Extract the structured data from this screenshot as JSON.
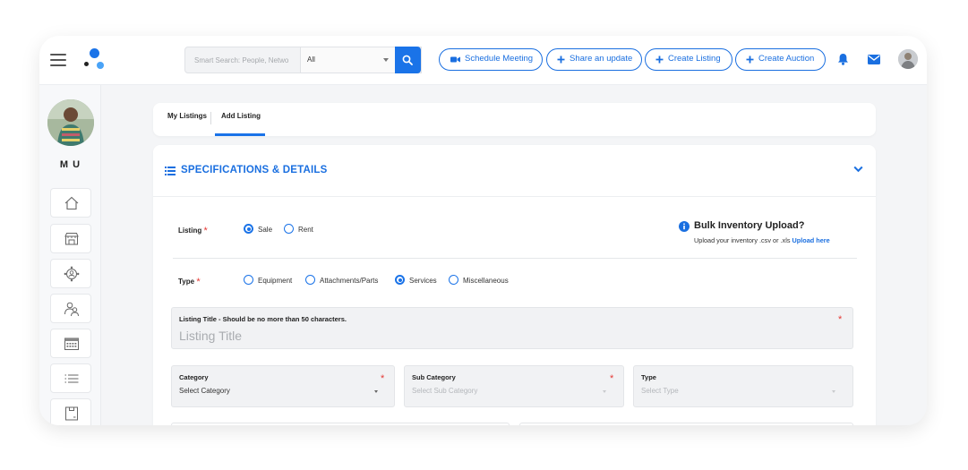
{
  "topbar": {
    "search": {
      "placeholder": "Smart Search: People, Netwo",
      "scope": "All"
    },
    "actions": [
      {
        "label": "Schedule Meeting",
        "icon": "video-camera-icon"
      },
      {
        "label": "Share an update",
        "icon": "plus-icon"
      },
      {
        "label": "Create Listing",
        "icon": "plus-icon"
      },
      {
        "label": "Create Auction",
        "icon": "plus-icon"
      }
    ],
    "icons": [
      "hamburger-icon",
      "bell-icon",
      "mail-icon",
      "search-icon"
    ],
    "accent": "#1a73e8"
  },
  "sidebar": {
    "user_initials": "M U",
    "items": [
      "home-icon",
      "store-icon",
      "network-icon",
      "users-icon",
      "calendar-icon",
      "list-icon",
      "box-icon"
    ]
  },
  "tabs": [
    {
      "label": "My Listings",
      "active": false
    },
    {
      "label": "Add Listing",
      "active": true
    }
  ],
  "section": {
    "title": "SPECIFICATIONS & DETAILS",
    "listing": {
      "label": "Listing",
      "required": "*",
      "options": [
        {
          "label": "Sale",
          "checked": true
        },
        {
          "label": "Rent",
          "checked": false
        }
      ]
    },
    "bulk": {
      "title": "Bulk Inventory Upload?",
      "text": "Upload your inventory .csv or .xls",
      "link": "Upload here"
    },
    "type": {
      "label": "Type",
      "required": "*",
      "options": [
        {
          "label": "Equipment",
          "checked": false
        },
        {
          "label": "Attachments/Parts",
          "checked": false
        },
        {
          "label": "Services",
          "checked": true
        },
        {
          "label": "Miscellaneous",
          "checked": false
        }
      ]
    },
    "listing_title": {
      "label": "Listing Title - Should be no more than 50 characters.",
      "placeholder": "Listing Title",
      "required": "*"
    },
    "category": {
      "label": "Category",
      "value": "Select Category",
      "required": "*"
    },
    "sub_category": {
      "label": "Sub Category",
      "value": "Select Sub Category",
      "required": "*"
    },
    "type_select": {
      "label": "Type",
      "value": "Select Type"
    }
  }
}
